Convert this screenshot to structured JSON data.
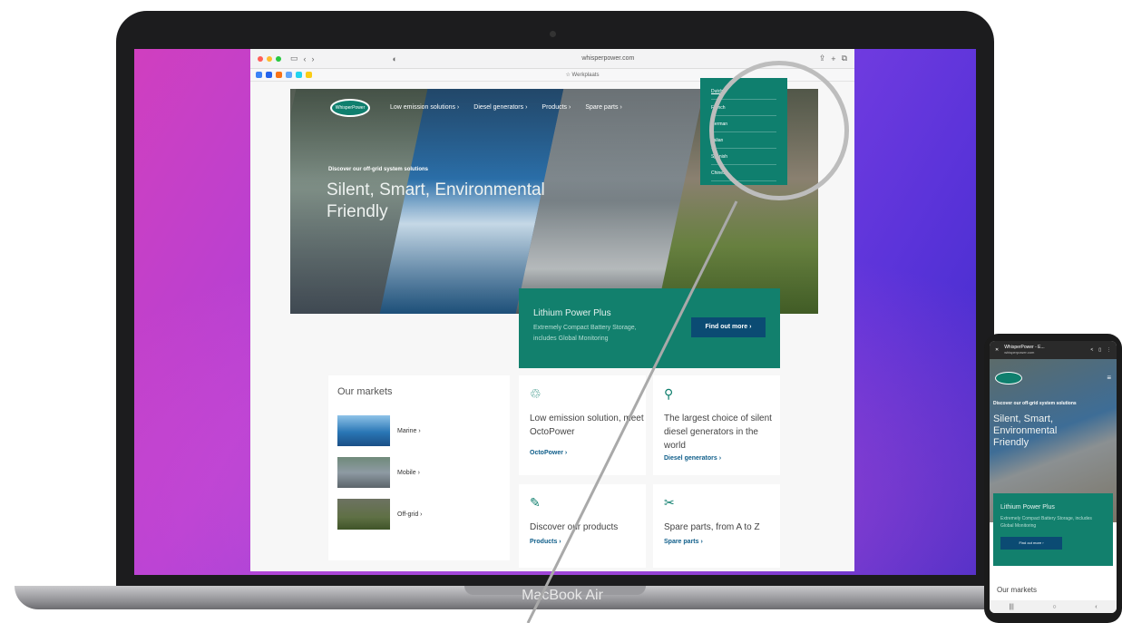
{
  "browser": {
    "url": "whisperpower.com",
    "favorites_center": "☆ Werkplaats"
  },
  "site": {
    "logo_text": "WhisperPower",
    "nav": [
      "Low emission solutions ›",
      "Diesel generators ›",
      "Products ›",
      "Spare parts ›"
    ],
    "hero_kicker": "Discover our off-grid system solutions",
    "hero_title": "Silent, Smart, Environmental Friendly",
    "languages": [
      "Dutch",
      "French",
      "German",
      "Italian",
      "Spanish",
      "Chinese"
    ],
    "promo_title": "Lithium Power Plus",
    "promo_sub": "Extremely Compact Battery Storage, includes Global Monitoring",
    "promo_button": "Find out more ›",
    "markets_title": "Our markets",
    "markets": [
      "Marine ›",
      "Mobile ›",
      "Off-grid ›"
    ],
    "cards": [
      {
        "text": "Low emission solution, meet OctoPower",
        "link": "OctoPower ›"
      },
      {
        "text": "The largest choice of silent diesel generators in the world",
        "link": "Diesel generators ›"
      },
      {
        "text": "Discover our products",
        "link": "Products ›"
      },
      {
        "text": "Spare parts, from A to Z",
        "link": "Spare parts ›"
      }
    ]
  },
  "laptop_label": "MacBook Air",
  "phone": {
    "tab_title": "WhisperPower - E...",
    "tab_url": "whisperpower.com",
    "hero_kicker": "Discover our off-grid system solutions",
    "hero_title": "Silent, Smart, Environmental Friendly",
    "promo_title": "Lithium Power Plus",
    "promo_sub": "Extremely Compact Battery Storage, includes Global Monitoring",
    "promo_button": "Find out more ›",
    "markets_title": "Our markets"
  },
  "colors": {
    "brand": "#0f7f6e",
    "button": "#0b4b73"
  }
}
